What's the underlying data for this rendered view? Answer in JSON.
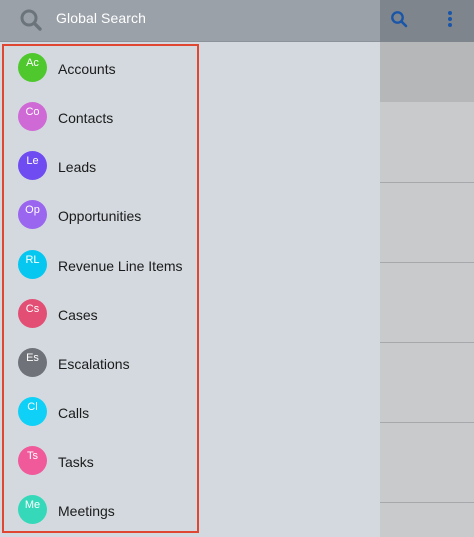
{
  "search": {
    "label": "Global Search"
  },
  "icons": {
    "search": "search-icon",
    "more": "more-vertical-icon"
  },
  "colors": {
    "highlight_border": "#e04733",
    "toolbar_icon": "#1a56a8"
  },
  "menu": {
    "items": [
      {
        "abbr": "Ac",
        "label": "Accounts",
        "color": "#4fc82e"
      },
      {
        "abbr": "Co",
        "label": "Contacts",
        "color": "#cf69d5"
      },
      {
        "abbr": "Le",
        "label": "Leads",
        "color": "#6f4cf1"
      },
      {
        "abbr": "Op",
        "label": "Opportunities",
        "color": "#9a66ef"
      },
      {
        "abbr": "RL",
        "label": "Revenue Line Items",
        "color": "#06c7f0"
      },
      {
        "abbr": "Cs",
        "label": "Cases",
        "color": "#e34f74"
      },
      {
        "abbr": "Es",
        "label": "Escalations",
        "color": "#6f7279"
      },
      {
        "abbr": "Cl",
        "label": "Calls",
        "color": "#0fd0f6"
      },
      {
        "abbr": "Ts",
        "label": "Tasks",
        "color": "#f0599a"
      },
      {
        "abbr": "Me",
        "label": "Meetings",
        "color": "#35d9ba"
      }
    ]
  }
}
